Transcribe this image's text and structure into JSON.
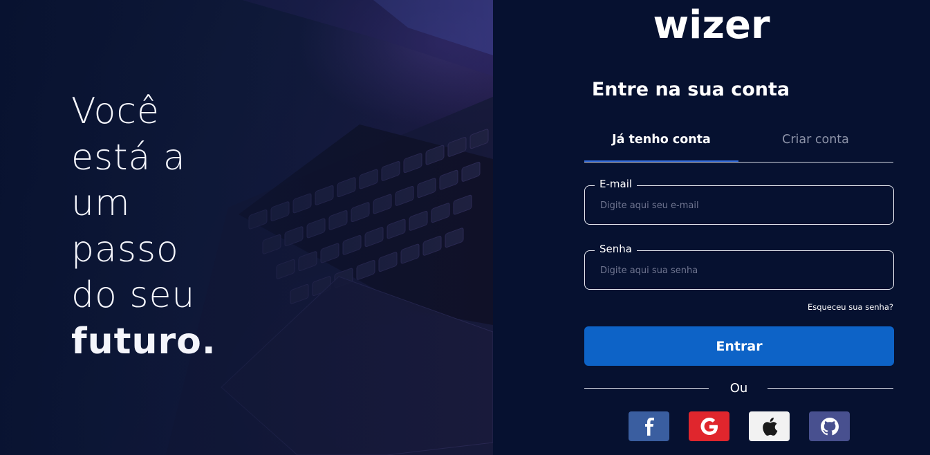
{
  "hero": {
    "line1": "Você",
    "line2": "está a",
    "line3": "um",
    "line4": "passo",
    "line5": "do seu",
    "line6_bold": "futuro",
    "line6_dot": "."
  },
  "brand": {
    "logo_text": "wizer"
  },
  "login": {
    "title": "Entre na sua conta",
    "tabs": [
      {
        "label": "Já tenho conta",
        "active": true
      },
      {
        "label": "Criar conta",
        "active": false
      }
    ],
    "email": {
      "label": "E-mail",
      "placeholder": "Digite aqui seu e-mail",
      "value": ""
    },
    "password": {
      "label": "Senha",
      "placeholder": "Digite aqui sua senha",
      "value": ""
    },
    "forgot_label": "Esqueceu sua senha?",
    "submit_label": "Entrar",
    "divider_label": "Ou",
    "social": [
      {
        "name": "facebook-icon",
        "color": "#3a5ea0"
      },
      {
        "name": "google-icon",
        "color": "#e0262d"
      },
      {
        "name": "apple-icon",
        "color": "#f2f2f2"
      },
      {
        "name": "github-icon",
        "color": "#48508f"
      }
    ]
  },
  "colors": {
    "background": "#061130",
    "accent": "#0d63c7",
    "tab_underline": "#2f68d8"
  }
}
